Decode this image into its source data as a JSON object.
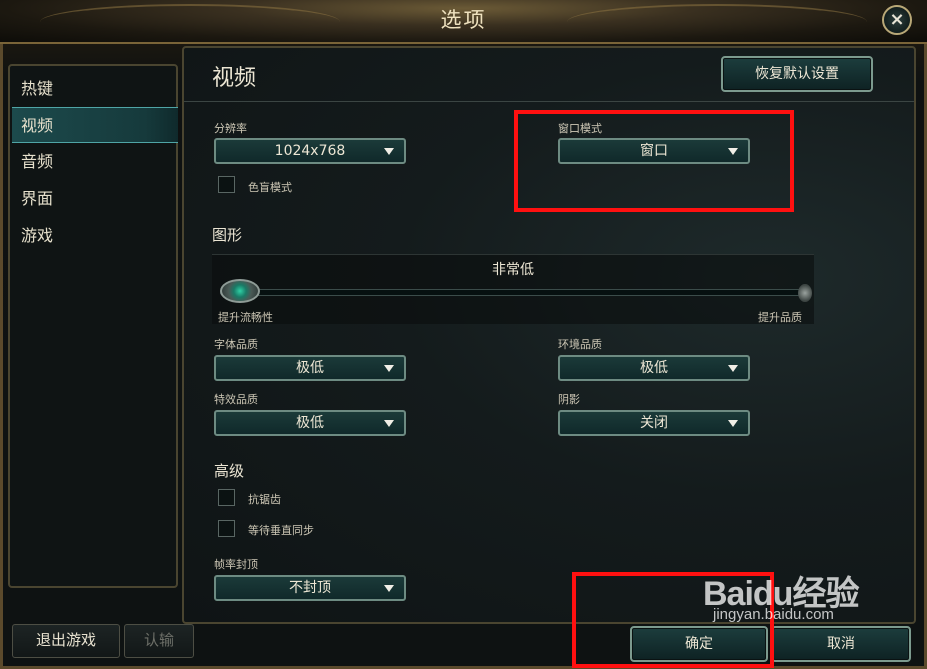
{
  "window": {
    "title": "选项",
    "close_icon": "×"
  },
  "sidebar": {
    "items": [
      {
        "label": "热键"
      },
      {
        "label": "视频",
        "active": true
      },
      {
        "label": "音频"
      },
      {
        "label": "界面"
      },
      {
        "label": "游戏"
      }
    ]
  },
  "main": {
    "title": "视频",
    "restore_defaults": "恢复默认设置",
    "resolution": {
      "label": "分辨率",
      "value": "1024x768"
    },
    "window_mode": {
      "label": "窗口模式",
      "value": "窗口"
    },
    "colorblind": {
      "label": "色盲模式",
      "checked": false
    },
    "graphics": {
      "section": "图形",
      "slider": {
        "value_label": "非常低",
        "min_label": "提升流畅性",
        "max_label": "提升品质",
        "level": 0
      }
    },
    "font_quality": {
      "label": "字体品质",
      "value": "极低"
    },
    "env_quality": {
      "label": "环境品质",
      "value": "极低"
    },
    "effects_quality": {
      "label": "特效品质",
      "value": "极低"
    },
    "shadows": {
      "label": "阴影",
      "value": "关闭"
    },
    "advanced": {
      "section": "高级",
      "antialiasing": {
        "label": "抗锯齿",
        "checked": false
      },
      "vsync": {
        "label": "等待垂直同步",
        "checked": false
      }
    },
    "frame_cap": {
      "label": "帧率封顶",
      "value": "不封顶"
    }
  },
  "footer": {
    "exit_game": "退出游戏",
    "surrender": "认输",
    "ok": "确定",
    "cancel": "取消"
  },
  "watermark": {
    "brand": "Baidu经验",
    "url": "jingyan.baidu.com"
  },
  "colors": {
    "accent": "#1c4a4c",
    "highlight": "#ff1010",
    "gold": "#7a6438"
  }
}
